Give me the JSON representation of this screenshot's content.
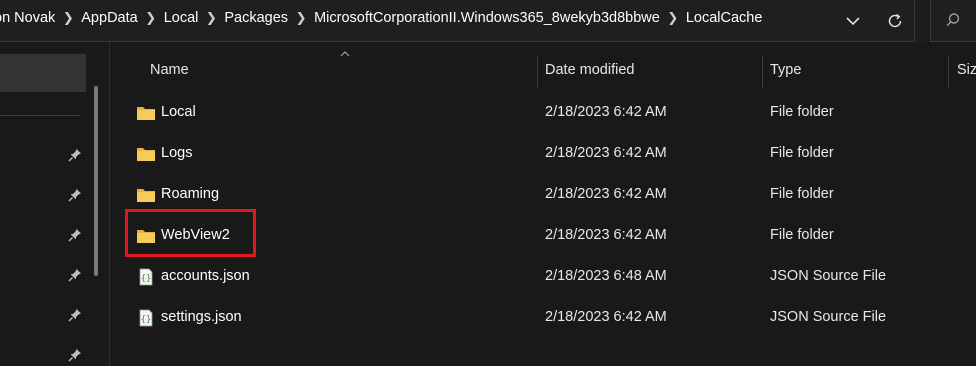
{
  "breadcrumb": [
    "on Novak",
    "AppData",
    "Local",
    "Packages",
    "MicrosoftCorporationII.Windows365_8wekyb3d8bbwe",
    "LocalCache"
  ],
  "columns": {
    "name": "Name",
    "date": "Date modified",
    "type": "Type",
    "size": "Siz"
  },
  "files": [
    {
      "name": "Local",
      "date": "2/18/2023 6:42 AM",
      "type": "File folder",
      "icon": "folder-icon"
    },
    {
      "name": "Logs",
      "date": "2/18/2023 6:42 AM",
      "type": "File folder",
      "icon": "folder-icon"
    },
    {
      "name": "Roaming",
      "date": "2/18/2023 6:42 AM",
      "type": "File folder",
      "icon": "folder-icon"
    },
    {
      "name": "WebView2",
      "date": "2/18/2023 6:42 AM",
      "type": "File folder",
      "icon": "folder-icon"
    },
    {
      "name": "accounts.json",
      "date": "2/18/2023 6:48 AM",
      "type": "JSON Source File",
      "icon": "json-file-icon"
    },
    {
      "name": "settings.json",
      "date": "2/18/2023 6:42 AM",
      "type": "JSON Source File",
      "icon": "json-file-icon"
    }
  ],
  "highlighted_item": "WebView2",
  "colors": {
    "background": "#191919",
    "highlight_box": "#e0181b",
    "folder": "#f2c94c"
  }
}
